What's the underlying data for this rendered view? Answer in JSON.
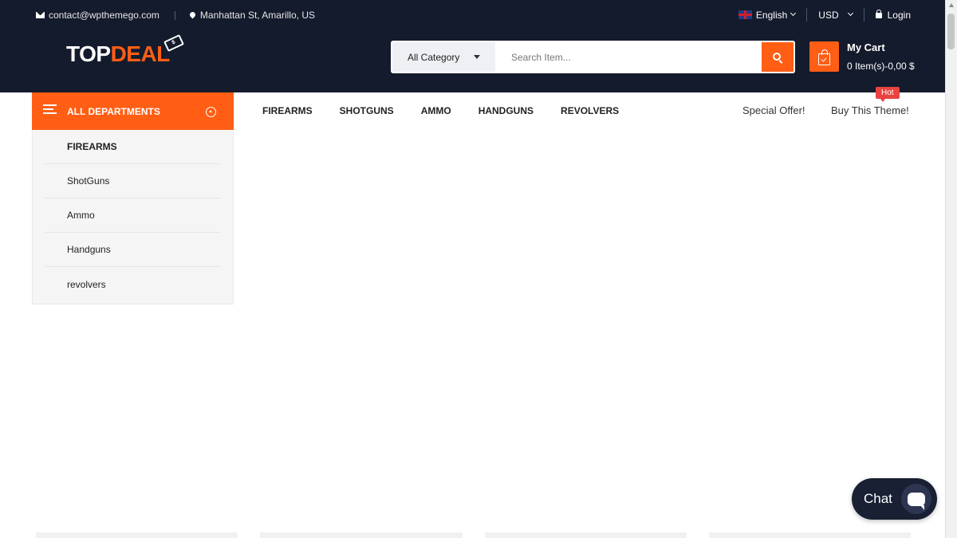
{
  "topbar": {
    "email": "contact@wpthemego.com",
    "address": "Manhattan St, Amarillo, US",
    "language": "English",
    "currency": "USD",
    "login": "Login"
  },
  "logo": {
    "part1": "TOP",
    "part2": "DEAL"
  },
  "search": {
    "category": "All Category",
    "placeholder": "Search Item..."
  },
  "cart": {
    "title": "My Cart",
    "summary": "0 Item(s)-0,00 $"
  },
  "departments": {
    "heading": "ALL DEPARTMENTS",
    "items": [
      {
        "label": "FIREARMS"
      },
      {
        "label": "ShotGuns"
      },
      {
        "label": "Ammo"
      },
      {
        "label": "Handguns"
      },
      {
        "label": "revolvers"
      }
    ]
  },
  "mainnav": {
    "items": [
      {
        "label": "FIREARMS"
      },
      {
        "label": "SHOTGUNS"
      },
      {
        "label": "AMMO"
      },
      {
        "label": "HANDGUNS"
      },
      {
        "label": "REVOLVERS"
      }
    ],
    "special_offer": "Special Offer!",
    "buy_theme": "Buy This Theme!",
    "hot_badge": "Hot"
  },
  "chat": {
    "label": "Chat"
  },
  "colors": {
    "header_bg": "#141b2d",
    "accent": "#ff5e14",
    "hot_badge": "#e9423f",
    "chat_bg": "#1a2033"
  },
  "icons": [
    "mail-icon",
    "map-pin-icon",
    "uk-flag-icon",
    "lock-icon",
    "search-icon",
    "shopping-bag-icon",
    "menu-icon",
    "arrow-up-circle-icon",
    "chat-bubble-icon"
  ]
}
